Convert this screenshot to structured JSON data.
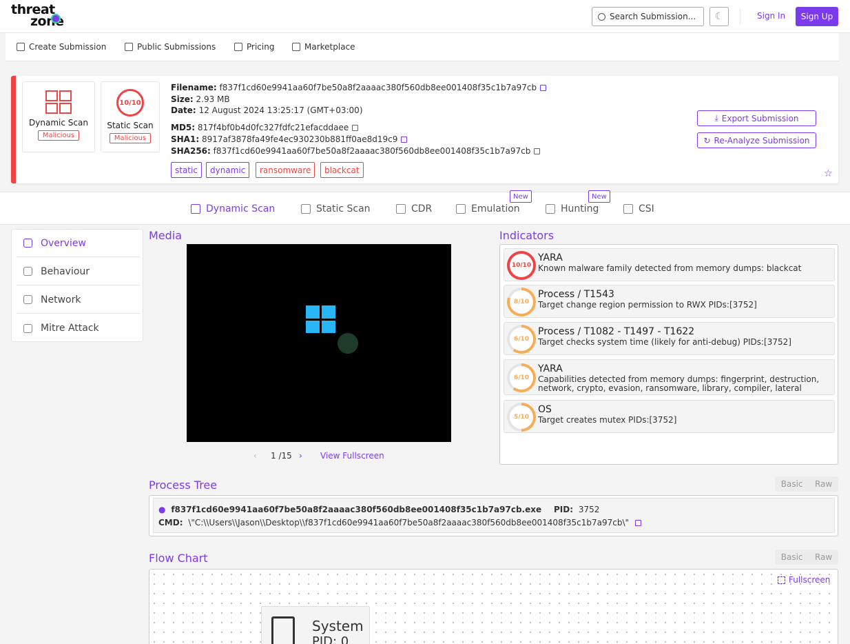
{
  "brand": {
    "line1": "threat",
    "line2": "zone"
  },
  "header": {
    "search_placeholder": "Search Submission...",
    "signin": "Sign In",
    "signup": "Sign Up"
  },
  "nav": [
    "Create Submission",
    "Public Submissions",
    "Pricing",
    "Marketplace"
  ],
  "scan_cards": [
    {
      "label": "Dynamic Scan",
      "verdict": "Malicious"
    },
    {
      "label": "Static Scan",
      "score": "10/10",
      "verdict": "Malicious"
    }
  ],
  "file": {
    "filename_label": "Filename:",
    "filename": "f837f1cd60e9941aa60f7be50a8f2aaaac380f560db8ee001408f35c1b7a97cb",
    "size_label": "Size:",
    "size": "2.93 MB",
    "date_label": "Date:",
    "date": "12 August 2024 13:25:17 (GMT+03:00)",
    "md5_label": "MD5:",
    "md5": "817f4bf0b4d0fc327fdfc21efacddaee",
    "sha1_label": "SHA1:",
    "sha1": "8917af3878fa49fe4ec930230b881ff0ae8d19c9",
    "sha256_label": "SHA256:",
    "sha256": "f837f1cd60e9941aa60f7be50a8f2aaaac380f560db8ee001408f35c1b7a97cb"
  },
  "tags": [
    "static",
    "dynamic",
    "ransomware",
    "blackcat"
  ],
  "actions": {
    "export": "Export Submission",
    "reanalyze": "Re-Analyze Submission"
  },
  "tabs": [
    {
      "label": "Dynamic Scan",
      "active": true
    },
    {
      "label": "Static Scan"
    },
    {
      "label": "CDR"
    },
    {
      "label": "Emulation",
      "badge": "New"
    },
    {
      "label": "Hunting",
      "badge": "New"
    },
    {
      "label": "CSI"
    }
  ],
  "sidebar": [
    "Overview",
    "Behaviour",
    "Network",
    "Mitre Attack"
  ],
  "media": {
    "title": "Media",
    "page": "1 /15",
    "fullscreen": "View Fullscreen"
  },
  "indicators": {
    "title": "Indicators",
    "items": [
      {
        "score": "10/10",
        "level": 1.0,
        "color": "#ef4444",
        "title": "YARA",
        "desc": "Known malware family detected from memory dumps: blackcat"
      },
      {
        "score": "8/10",
        "level": 0.8,
        "color": "#f6ad55",
        "title": "Process / T1543",
        "desc": "Target change region permission to RWX PIDs:[3752]"
      },
      {
        "score": "6/10",
        "level": 0.6,
        "color": "#f6ad55",
        "title": "Process / T1082 - T1497 - T1622",
        "desc": "Target checks system time (likely for anti-debug) PIDs:[3752]"
      },
      {
        "score": "6/10",
        "level": 0.6,
        "color": "#f6ad55",
        "title": "YARA",
        "desc": "Capabilities detected from memory dumps: fingerprint, destruction, network, crypto, evasion, ransomware, library, compiler, lateral"
      },
      {
        "score": "5/10",
        "level": 0.5,
        "color": "#f6ad55",
        "title": "OS",
        "desc": "Target creates mutex PIDs:[3752]"
      }
    ]
  },
  "process_tree": {
    "title": "Process Tree",
    "toggle": [
      "Basic",
      "Raw"
    ],
    "name": "f837f1cd60e9941aa60f7be50a8f2aaaac380f560db8ee001408f35c1b7a97cb.exe",
    "pid_label": "PID:",
    "pid": "3752",
    "cmd_label": "CMD:",
    "cmd": "\\\"C:\\\\Users\\\\Jason\\\\Desktop\\\\f837f1cd60e9941aa60f7be50a8f2aaaac380f560db8ee001408f35c1b7a97cb\\\""
  },
  "flow_chart": {
    "title": "Flow Chart",
    "toggle": [
      "Basic",
      "Raw"
    ],
    "fullscreen": "Fullscreen",
    "node_title": "System",
    "node_pid": "PID: 0"
  }
}
